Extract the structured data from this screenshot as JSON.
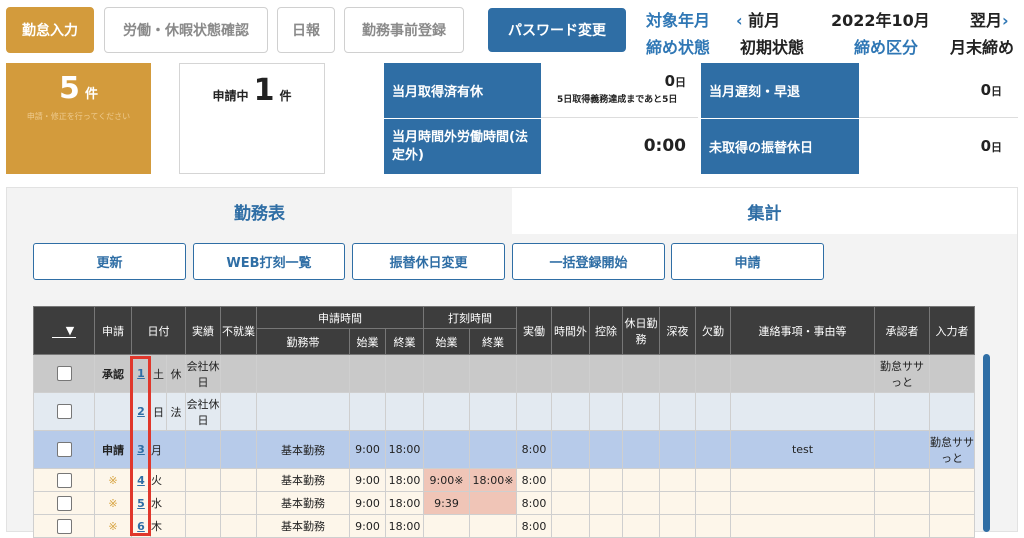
{
  "top_tabs": {
    "attendance_input": "勤怠入力",
    "leave_status": "労働・休暇状態確認",
    "daily_report": "日報",
    "pre_registration": "勤務事前登録",
    "password_change": "パスワード変更"
  },
  "period": {
    "target_label": "対象年月",
    "prev_label": "前月",
    "current": "2022年10月",
    "next_label": "翌月",
    "closing_status_label": "締め状態",
    "closing_status_value": "初期状態",
    "closing_type_label": "締め区分",
    "closing_type_value": "月末締め"
  },
  "summary": {
    "pending_count": "5",
    "pending_unit": "件",
    "pending_note": "申請・修正を行ってください",
    "applying_label": "申請中",
    "applying_count": "1",
    "applying_unit": "件"
  },
  "stats": {
    "leave_taken_label": "当月取得済有休",
    "leave_taken_value": "0",
    "leave_taken_unit": "日",
    "leave_note": "5日取得義務達成まであと5日",
    "late_label": "当月遅刻・早退",
    "late_value": "0",
    "late_unit": "日",
    "overtime_label": "当月時間外労働時間(法定外)",
    "overtime_value": "0:00",
    "untaken_label": "未取得の振替休日",
    "untaken_value": "0",
    "untaken_unit": "日"
  },
  "panel_tabs": {
    "work_table": "勤務表",
    "totals": "集計"
  },
  "actions": {
    "refresh": "更新",
    "web_punch": "WEB打刻一覧",
    "holiday_change": "振替休日変更",
    "bulk_start": "一括登録開始",
    "apply": "申請"
  },
  "table": {
    "h_sort": "▼",
    "h_apply": "申請",
    "h_date": "日付",
    "h_result": "実績",
    "h_absent": "不就業",
    "h_req_time": "申請時間",
    "h_punch_time": "打刻時間",
    "h_actual": "実働",
    "h_overtime": "時間外",
    "h_deduct": "控除",
    "h_holiday_work": "休日勤務",
    "h_late_night": "深夜",
    "h_absence": "欠勤",
    "h_notes": "連絡事項・事由等",
    "h_approver": "承認者",
    "h_inputter": "入力者",
    "h_shift": "勤務帯",
    "h_start": "始業",
    "h_end": "終業",
    "h_punch_start": "始業",
    "h_punch_end": "終業",
    "rows": [
      {
        "status": "承認",
        "day": "1",
        "dow": "土",
        "kind": "休",
        "result": "会社休日",
        "shift": "",
        "start": "",
        "end": "",
        "pstart": "",
        "pend": "",
        "actual": "",
        "note": "",
        "approver": "勤怠ササっと",
        "inputter": ""
      },
      {
        "status": "",
        "day": "2",
        "dow": "日",
        "kind": "法",
        "result": "会社休日",
        "shift": "",
        "start": "",
        "end": "",
        "pstart": "",
        "pend": "",
        "actual": "",
        "note": "",
        "approver": "",
        "inputter": ""
      },
      {
        "status": "申請",
        "day": "3",
        "dow": "月",
        "kind": "",
        "result": "",
        "shift": "基本勤務",
        "start": "9:00",
        "end": "18:00",
        "pstart": "",
        "pend": "",
        "actual": "8:00",
        "note": "test",
        "approver": "",
        "inputter": "勤怠ササっと"
      },
      {
        "status": "※",
        "day": "4",
        "dow": "火",
        "kind": "",
        "result": "",
        "shift": "基本勤務",
        "start": "9:00",
        "end": "18:00",
        "pstart": "9:00※",
        "pend": "18:00※",
        "actual": "8:00",
        "note": "",
        "approver": "",
        "inputter": ""
      },
      {
        "status": "※",
        "day": "5",
        "dow": "水",
        "kind": "",
        "result": "",
        "shift": "基本勤務",
        "start": "9:00",
        "end": "18:00",
        "pstart": "9:39",
        "pend": "",
        "actual": "8:00",
        "note": "",
        "approver": "",
        "inputter": ""
      },
      {
        "status": "※",
        "day": "6",
        "dow": "木",
        "kind": "",
        "result": "",
        "shift": "基本勤務",
        "start": "9:00",
        "end": "18:00",
        "pstart": "",
        "pend": "",
        "actual": "8:00",
        "note": "",
        "approver": "",
        "inputter": ""
      }
    ]
  }
}
